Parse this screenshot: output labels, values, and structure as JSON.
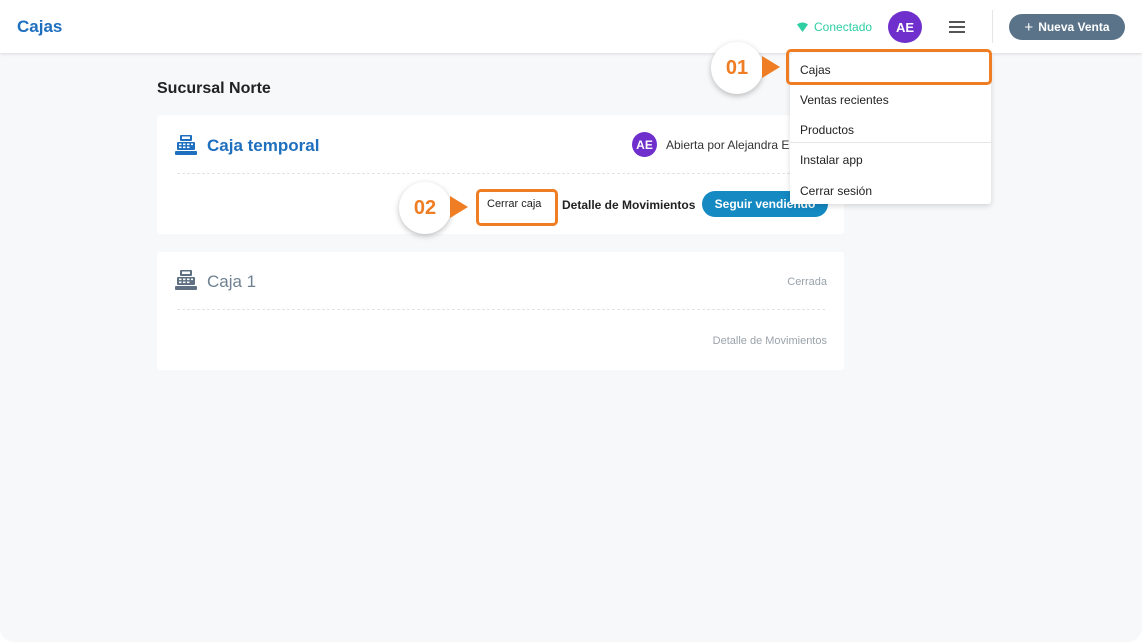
{
  "header": {
    "title": "Cajas",
    "status_text": "Conectado",
    "avatar_initials": "AE",
    "new_sale_label": "Nueva Venta",
    "plus_glyph": "+"
  },
  "branch": {
    "title": "Sucursal Norte"
  },
  "registers": [
    {
      "name": "Caja temporal",
      "avatar_initials": "AE",
      "opened_by": "Abierta por Alejandra Er",
      "close_label": "Cerrar caja",
      "detail_label": "Detalle de Movimientos",
      "continue_label": "Seguir vendiendo"
    },
    {
      "name": "Caja 1",
      "status": "Cerrada",
      "detail_label": "Detalle de Movimientos"
    }
  ],
  "menu": {
    "items": [
      "Cajas",
      "Ventas recientes",
      "Productos",
      "Instalar app",
      "Cerrar sesión"
    ]
  },
  "annotations": [
    {
      "label": "01"
    },
    {
      "label": "02"
    }
  ],
  "colors": {
    "brand": "#1f6fbf",
    "connected": "#2ecfa3",
    "avatar": "#6f2fcc",
    "primary_button": "#1489c2",
    "new_sale_button": "#5a7389",
    "annotation": "#ee7d23"
  },
  "icons": {
    "connection": "wifi-icon",
    "menu": "hamburger-menu-icon",
    "register": "cash-register-icon"
  }
}
